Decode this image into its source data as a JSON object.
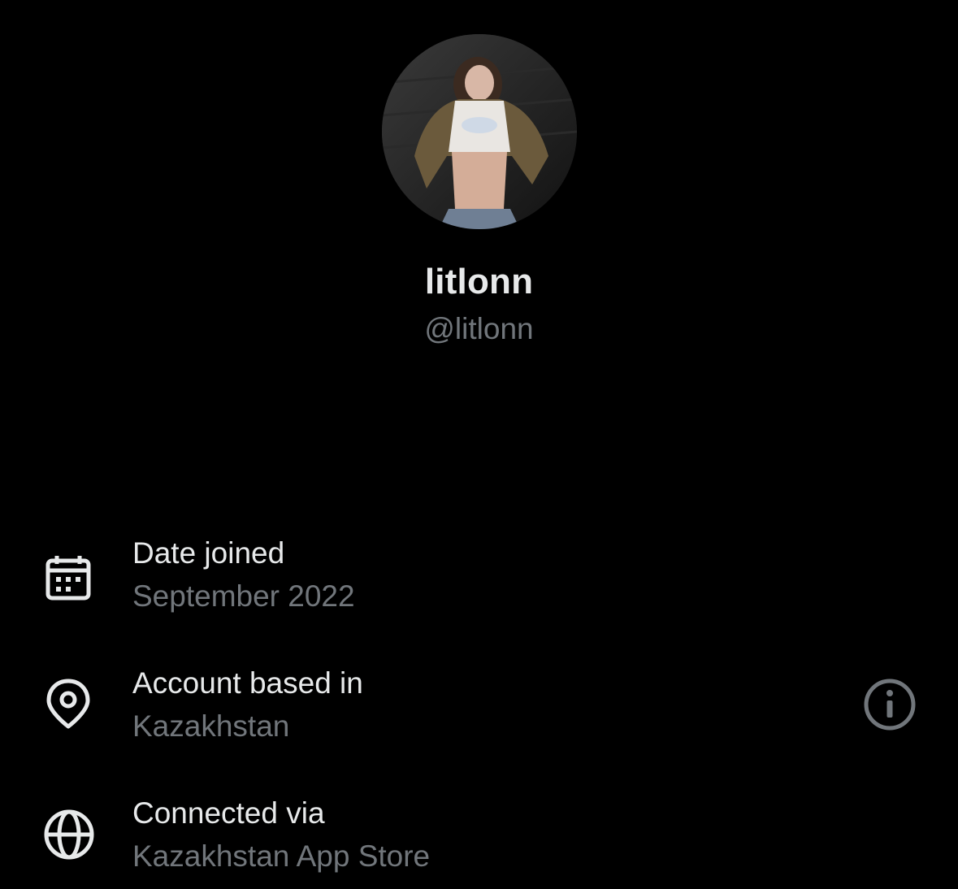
{
  "profile": {
    "display_name": "litlonn",
    "handle": "@litlonn"
  },
  "details": {
    "date_joined": {
      "icon": "calendar-icon",
      "title": "Date joined",
      "value": "September 2022"
    },
    "account_based_in": {
      "icon": "location-pin-icon",
      "title": "Account based in",
      "value": "Kazakhstan",
      "action_icon": "info-icon"
    },
    "connected_via": {
      "icon": "globe-icon",
      "title": "Connected via",
      "value": "Kazakhstan App Store"
    }
  },
  "colors": {
    "background": "#000000",
    "primary_text": "#e7e9ea",
    "secondary_text": "#71767b"
  }
}
